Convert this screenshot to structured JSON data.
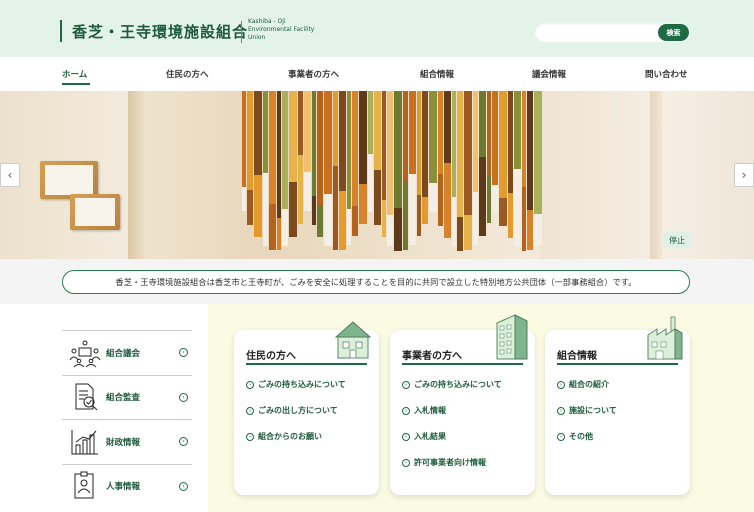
{
  "header": {
    "logo_jp": "香芝・王寺環境施設組合",
    "logo_en_lines": [
      "Kashiba - Oji",
      "Environmental Facility",
      "Union"
    ],
    "search_placeholder": "",
    "search_button": "検索"
  },
  "nav": {
    "items": [
      {
        "label": "ホーム"
      },
      {
        "label": "住民の方へ"
      },
      {
        "label": "事業者の方へ"
      },
      {
        "label": "組合情報"
      },
      {
        "label": "議会情報"
      },
      {
        "label": "問い合わせ"
      }
    ]
  },
  "hero": {
    "stop_label": "停止",
    "prev_icon": "chevron-left-icon",
    "next_icon": "chevron-right-icon"
  },
  "intro": {
    "text": "香芝・王寺環境施設組合は香芝市と王寺町が、ごみを安全に処理することを目的に共同で設立した特別地方公共団体（一部事務組合）です。"
  },
  "left_list": [
    {
      "label": "組合議会",
      "icon": "assembly-icon"
    },
    {
      "label": "組合監査",
      "icon": "audit-icon"
    },
    {
      "label": "財政情報",
      "icon": "chart-icon"
    },
    {
      "label": "人事情報",
      "icon": "personnel-icon"
    }
  ],
  "cards": [
    {
      "title": "住民の方へ",
      "icon": "house-icon",
      "links": [
        "ごみの持ち込みについて",
        "ごみの出し方について",
        "組合からのお願い"
      ]
    },
    {
      "title": "事業者の方へ",
      "icon": "office-building-icon",
      "links": [
        "ごみの持ち込みについて",
        "入札情報",
        "入札結果",
        "許可事業者向け情報"
      ]
    },
    {
      "title": "組合情報",
      "icon": "factory-icon",
      "links": [
        "組合の紹介",
        "施設について",
        "その他"
      ]
    }
  ],
  "colors": {
    "brand_green": "#1d6a44",
    "header_bg": "#e4f3ea",
    "panel_yellow": "#fbfae3"
  }
}
